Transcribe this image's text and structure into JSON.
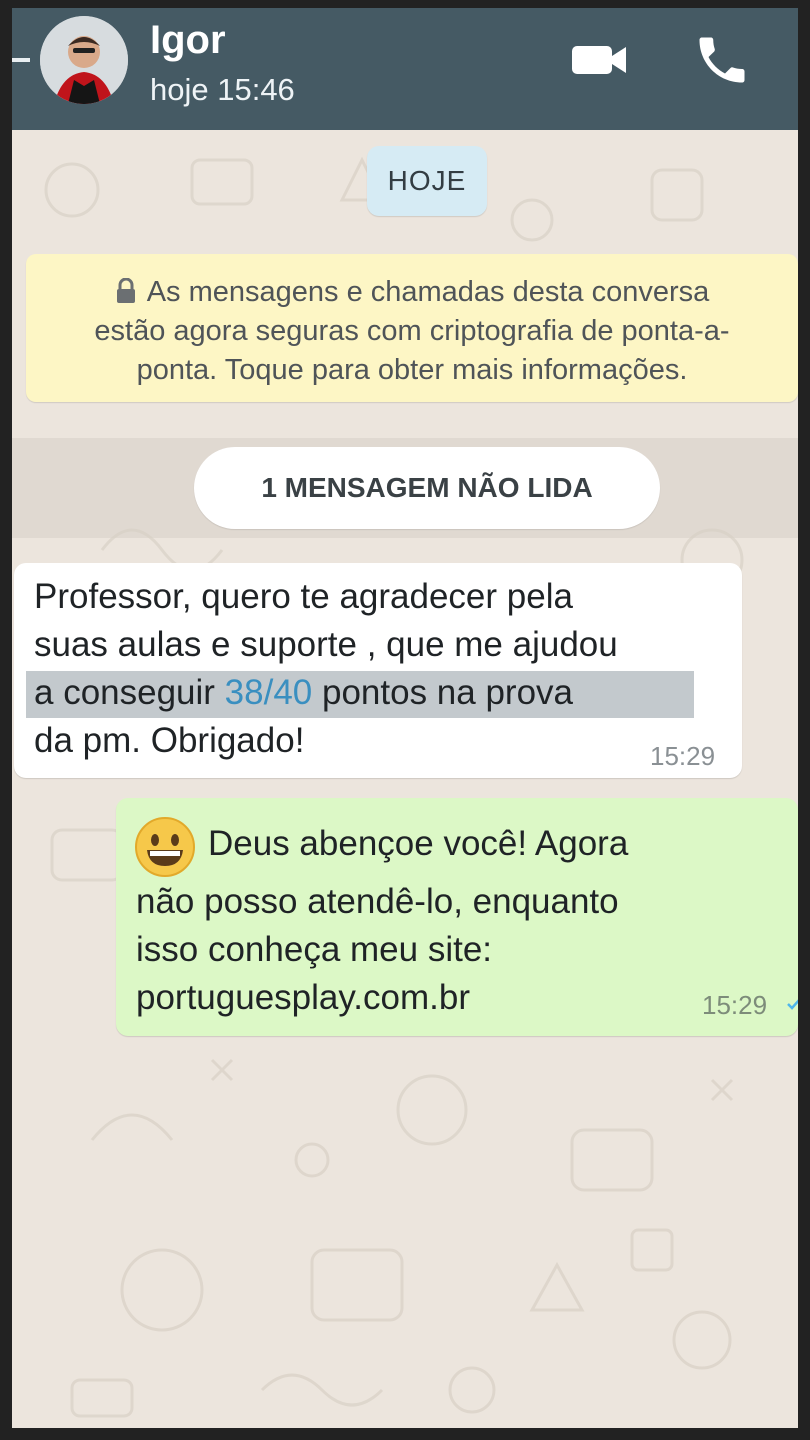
{
  "header": {
    "contact_name": "Igor",
    "status": "hoje 15:46",
    "background_color": "#455a64"
  },
  "icons": {
    "back": "back-arrow-icon",
    "video": "video-camera-icon",
    "phone": "phone-icon",
    "lock": "lock-icon",
    "emoji": "grinning-face-emoji",
    "delivered": "check-icon"
  },
  "chat": {
    "date_chip": "HOJE",
    "encryption_notice": {
      "line1": "As mensagens e chamadas desta conversa",
      "line2": "estão agora seguras com criptografia de ponta-a-",
      "line3": "ponta. Toque para obter mais informações."
    },
    "unread_divider": "1 MENSAGEM NÃO LIDA",
    "messages": [
      {
        "direction": "incoming",
        "line1": "Professor,  quero te agradecer pela",
        "line2": "suas aulas e suporte , que me ajudou",
        "line3_start": "a conseguir ",
        "line3_number": "38/40",
        "line3_end": " pontos na prova",
        "line4": "da pm. Obrigado!",
        "time": "15:29"
      },
      {
        "direction": "outgoing",
        "line1": "Deus abençoe você! Agora",
        "line2": "não posso atendê-lo, enquanto",
        "line3": "isso conheça meu site:",
        "link": "portuguesplay.com.br",
        "time": "15:29"
      }
    ]
  },
  "colors": {
    "outgoing_bubble": "#dcf8c6",
    "incoming_bubble": "#ffffff",
    "chat_background": "#ece5dd",
    "notice_background": "#fdf6c5",
    "date_chip_background": "#d6ebf4",
    "link": "#2e8fc5"
  }
}
